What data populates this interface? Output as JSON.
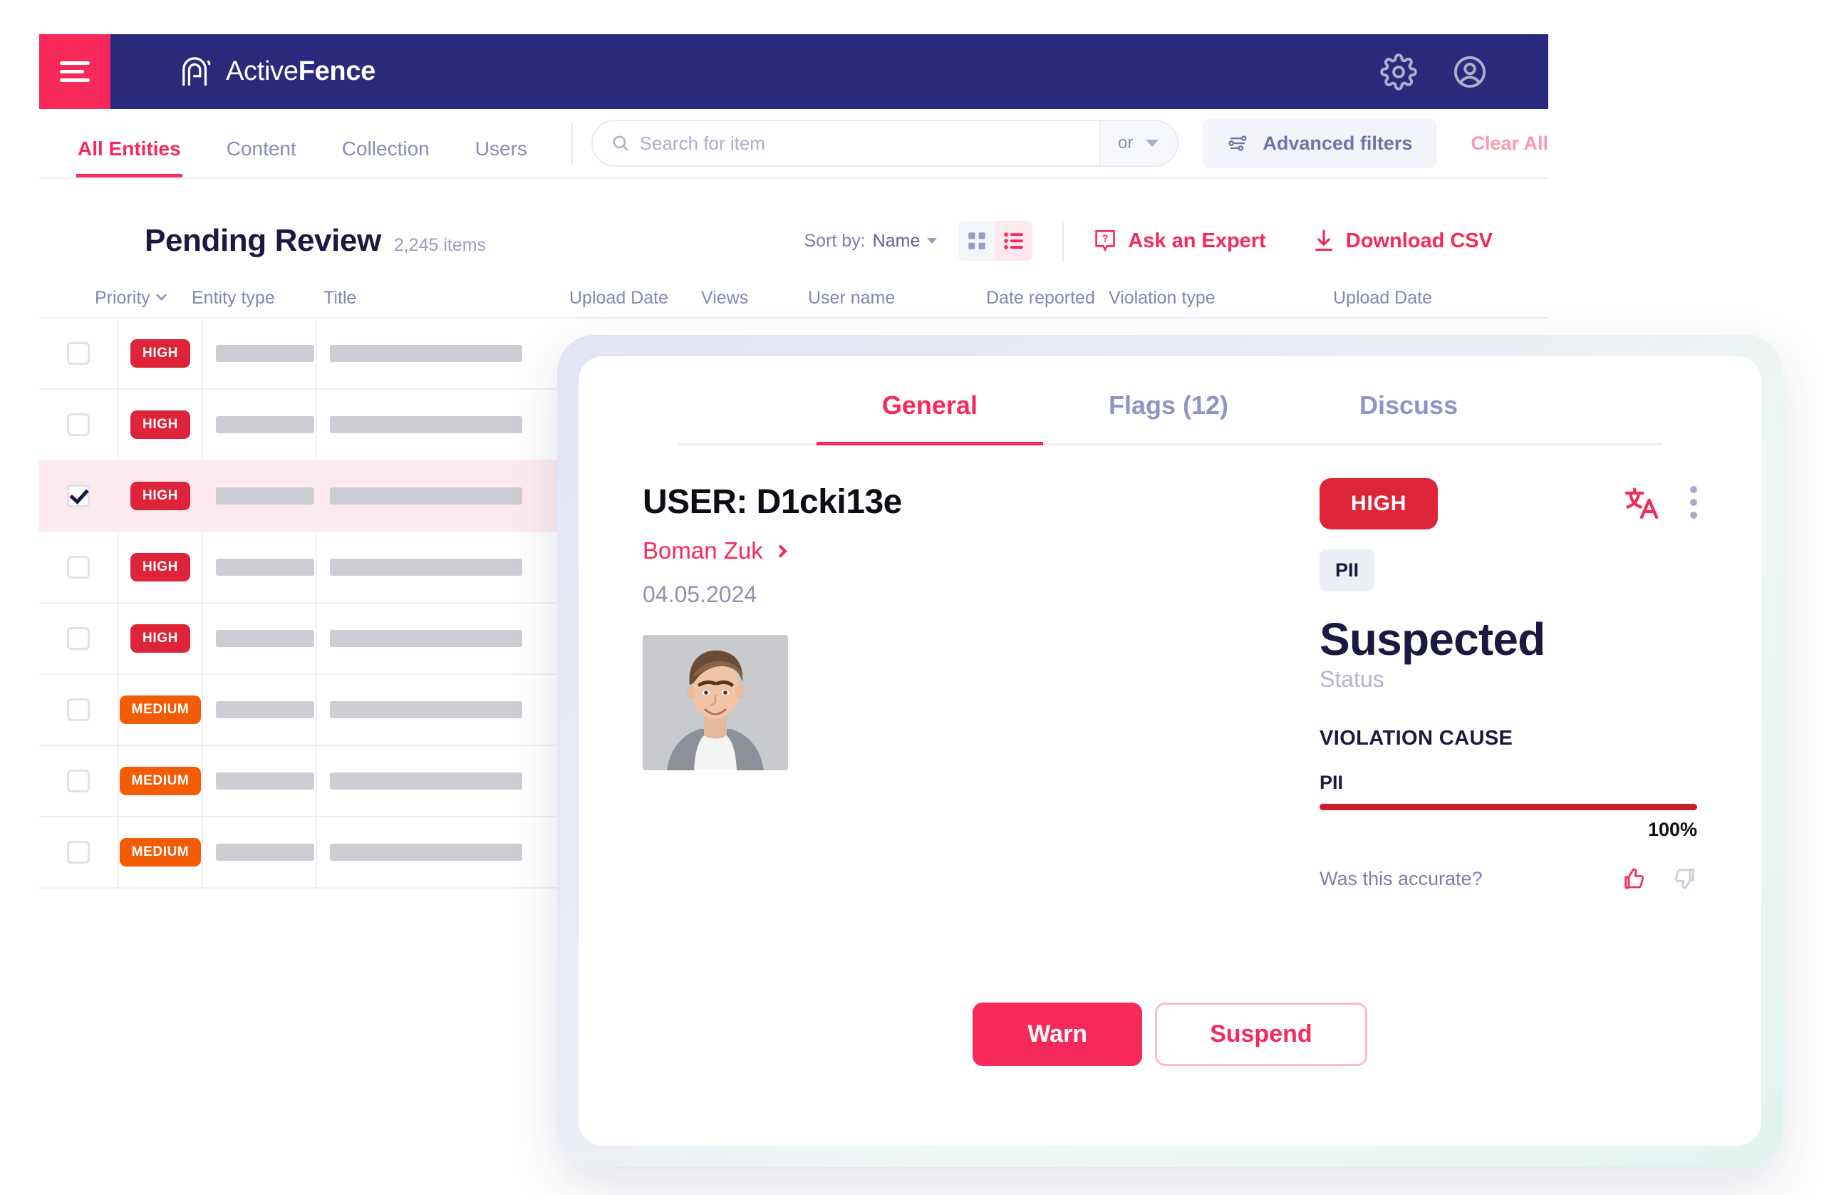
{
  "brand": {
    "name_light": "Active",
    "name_bold": "Fence",
    "logo_icon": "activefence-arch-logo",
    "menu_icon": "hamburger-menu-icon",
    "settings_icon": "gear-icon",
    "account_icon": "user-circle-icon"
  },
  "nav": {
    "tabs": [
      {
        "label": "All Entities",
        "active": true
      },
      {
        "label": "Content",
        "active": false
      },
      {
        "label": "Collection",
        "active": false
      },
      {
        "label": "Users",
        "active": false
      }
    ]
  },
  "search": {
    "placeholder": "Search for item",
    "value": "",
    "icon": "search-icon",
    "operator": "or",
    "operator_caret_icon": "chevron-down-icon"
  },
  "filters": {
    "advanced_label": "Advanced filters",
    "advanced_icon": "sliders-icon",
    "clear_label": "Clear All"
  },
  "page": {
    "title": "Pending Review",
    "count": "2,245 items",
    "sort_prefix": "Sort by:",
    "sort_value": "Name",
    "view_grid_icon": "grid-view-icon",
    "view_list_icon": "list-view-icon",
    "ask_expert": "Ask an Expert",
    "ask_expert_icon": "question-box-icon",
    "download_csv": "Download CSV",
    "download_icon": "download-arrow-icon"
  },
  "table": {
    "columns": [
      "Priority",
      "Entity type",
      "Title",
      "Upload Date",
      "Views",
      "User name",
      "Date reported",
      "Violation type",
      "Upload Date"
    ],
    "rows": [
      {
        "priority": "HIGH",
        "level": "high",
        "checked": false,
        "selected": false
      },
      {
        "priority": "HIGH",
        "level": "high",
        "checked": false,
        "selected": false
      },
      {
        "priority": "HIGH",
        "level": "high",
        "checked": true,
        "selected": true
      },
      {
        "priority": "HIGH",
        "level": "high",
        "checked": false,
        "selected": false
      },
      {
        "priority": "HIGH",
        "level": "high",
        "checked": false,
        "selected": false
      },
      {
        "priority": "MEDIUM",
        "level": "medium",
        "checked": false,
        "selected": false
      },
      {
        "priority": "MEDIUM",
        "level": "medium",
        "checked": false,
        "selected": false
      },
      {
        "priority": "MEDIUM",
        "level": "medium",
        "checked": false,
        "selected": false
      }
    ]
  },
  "detail": {
    "tabs": [
      {
        "label": "General",
        "active": true
      },
      {
        "label": "Flags (12)",
        "active": false
      },
      {
        "label": "Discuss",
        "active": false
      }
    ],
    "user_title": "USER: D1cki13e",
    "user_link": "Boman Zuk",
    "user_link_icon": "chevron-right-icon",
    "date": "04.05.2024",
    "photo_alt": "user-avatar-photo",
    "priority_badge": "HIGH",
    "translate_icon": "translate-icon",
    "more_icon": "kebab-menu-icon",
    "tag": "PII",
    "status_value": "Suspected",
    "status_label": "Status",
    "violation_cause_title": "VIOLATION CAUSE",
    "violation_cause_value": "PII",
    "confidence_percent": "100%",
    "confidence_fill": 100,
    "accuracy_question": "Was this accurate?",
    "thumb_up_icon": "thumbs-up-icon",
    "thumb_down_icon": "thumbs-down-icon",
    "warn_label": "Warn",
    "suspend_label": "Suspend"
  },
  "colors": {
    "navy": "#2a2a7c",
    "pink": "#f7295a",
    "red_high": "#dd2438",
    "orange_medium": "#f25c05",
    "muted_purple": "#8a8bb8",
    "ink": "#1b1940"
  }
}
